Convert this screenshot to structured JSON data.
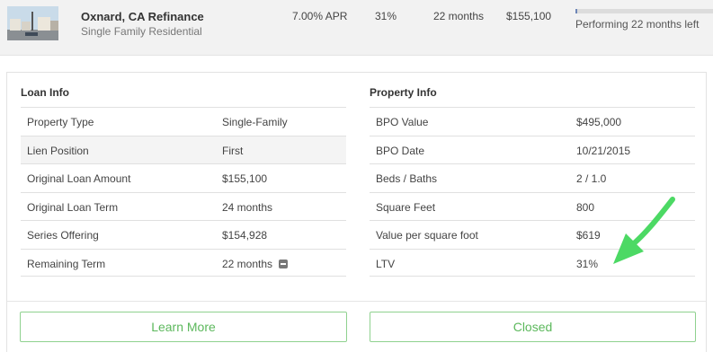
{
  "summary": {
    "title": "Oxnard, CA Refinance",
    "subtitle": "Single Family Residential",
    "apr": "7.00% APR",
    "ltv": "31%",
    "term": "22 months",
    "amount": "$155,100",
    "progress_fraction": 0.01,
    "status": "Performing 22 months left"
  },
  "loan_info": {
    "heading": "Loan Info",
    "rows": [
      {
        "label": "Property Type",
        "value": "Single-Family"
      },
      {
        "label": "Lien Position",
        "value": "First"
      },
      {
        "label": "Original Loan Amount",
        "value": "$155,100"
      },
      {
        "label": "Original Loan Term",
        "value": "24 months"
      },
      {
        "label": "Series Offering",
        "value": "$154,928"
      },
      {
        "label": "Remaining Term",
        "value": "22 months"
      }
    ]
  },
  "property_info": {
    "heading": "Property Info",
    "rows": [
      {
        "label": "BPO Value",
        "value": "$495,000"
      },
      {
        "label": "BPO Date",
        "value": "10/21/2015"
      },
      {
        "label": "Beds / Baths",
        "value": "2 / 1.0"
      },
      {
        "label": "Square Feet",
        "value": "800"
      },
      {
        "label": "Value per square foot",
        "value": "$619"
      },
      {
        "label": "LTV",
        "value": "31%"
      }
    ]
  },
  "actions": {
    "learn_more": "Learn More",
    "closed": "Closed"
  },
  "colors": {
    "accent_green": "#5cb85c",
    "annotation_arrow": "#4cd964"
  },
  "icons": {
    "remaining_term": "minus-square-icon",
    "annotation": "green-arrow-icon"
  }
}
